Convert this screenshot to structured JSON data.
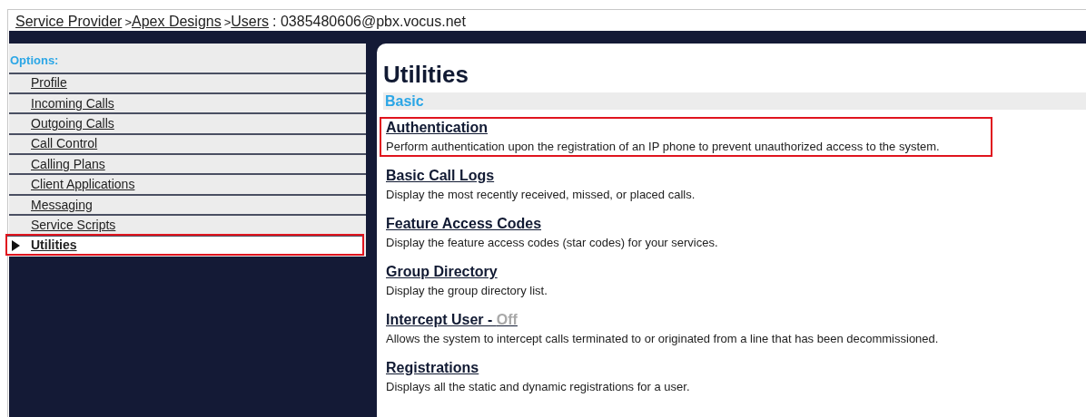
{
  "breadcrumb": [
    {
      "kind": "link",
      "text": "Service Provider"
    },
    {
      "kind": "separator",
      "text": ">"
    },
    {
      "kind": "link",
      "text": "Apex Designs"
    },
    {
      "kind": "separator",
      "text": ">"
    },
    {
      "kind": "link",
      "text": "Users"
    },
    {
      "kind": "text",
      "text": ": 0385480606@pbx.vocus.net"
    }
  ],
  "sidebar": {
    "heading": "Options:",
    "items": [
      {
        "label": "Profile",
        "selected": false,
        "highlighted": false
      },
      {
        "label": "Incoming Calls",
        "selected": false,
        "highlighted": false
      },
      {
        "label": "Outgoing Calls",
        "selected": false,
        "highlighted": false
      },
      {
        "label": "Call Control",
        "selected": false,
        "highlighted": false
      },
      {
        "label": "Calling Plans",
        "selected": false,
        "highlighted": false
      },
      {
        "label": "Client Applications",
        "selected": false,
        "highlighted": false
      },
      {
        "label": "Messaging",
        "selected": false,
        "highlighted": false
      },
      {
        "label": "Service Scripts",
        "selected": false,
        "highlighted": false
      },
      {
        "label": "Utilities",
        "selected": true,
        "highlighted": true
      }
    ]
  },
  "page": {
    "title": "Utilities",
    "section": "Basic",
    "items": [
      {
        "title": "Authentication",
        "description": "Perform authentication upon the registration of an IP phone to prevent unauthorized access to the system.",
        "highlighted": true
      },
      {
        "title": "Basic Call Logs",
        "description": "Display the most recently received, missed, or placed calls.",
        "highlighted": false
      },
      {
        "title": "Feature Access Codes",
        "description": "Display the feature access codes (star codes) for your services.",
        "highlighted": false
      },
      {
        "title": "Group Directory",
        "description": "Display the group directory list.",
        "highlighted": false
      },
      {
        "title": "Intercept User - ",
        "status": "Off",
        "description": "Allows the system to intercept calls terminated to or originated from a line that has been decommissioned.",
        "highlighted": false
      },
      {
        "title": "Registrations",
        "description": "Displays all the static and dynamic registrations for a user.",
        "highlighted": false
      }
    ]
  }
}
